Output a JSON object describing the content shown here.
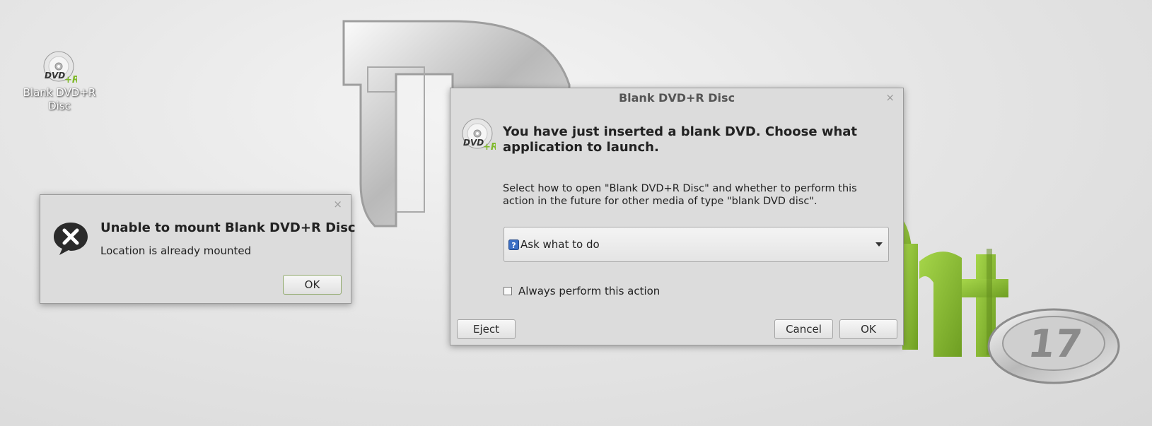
{
  "desktop": {
    "icon_label": "Blank DVD+R Disc"
  },
  "error_dialog": {
    "close": "×",
    "title": "Unable to mount Blank DVD+R Disc",
    "message": "Location is already mounted",
    "ok_label": "OK"
  },
  "dvd_dialog": {
    "window_title": "Blank DVD+R Disc",
    "close": "×",
    "heading": "You have just inserted a blank DVD. Choose what application to launch.",
    "description": "Select how to open \"Blank DVD+R Disc\" and whether to perform this action in the future for other media of type \"blank DVD disc\".",
    "combo_selected": "Ask what to do",
    "always_label": "Always perform this action",
    "always_checked": false,
    "eject_label": "Eject",
    "cancel_label": "Cancel",
    "ok_label": "OK"
  },
  "wallpaper": {
    "version_number": "17"
  },
  "colors": {
    "mint_green": "#8cc63f",
    "dialog_bg": "#dcdcdc",
    "ok_border": "#8fa86a"
  }
}
